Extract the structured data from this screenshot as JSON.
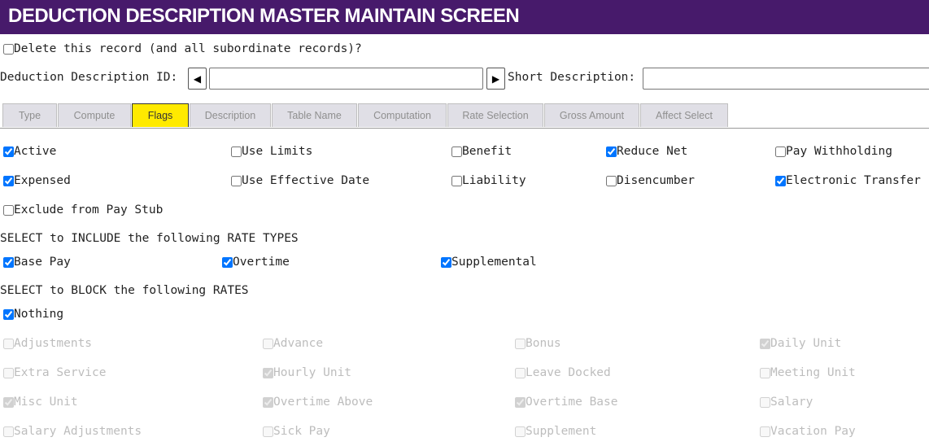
{
  "title": "DEDUCTION DESCRIPTION MASTER MAINTAIN SCREEN",
  "delete_record": {
    "label": "Delete this record (and all subordinate records)?",
    "checked": false
  },
  "deduction_id": {
    "label": "Deduction Description ID:",
    "value": "",
    "prev_icon": "triangle-left-icon",
    "next_icon": "triangle-right-icon"
  },
  "short_description": {
    "label": "Short Description:",
    "value": ""
  },
  "tabs": [
    {
      "label": "Type"
    },
    {
      "label": "Compute"
    },
    {
      "label": "Flags",
      "active": true
    },
    {
      "label": "Description"
    },
    {
      "label": "Table Name"
    },
    {
      "label": "Computation"
    },
    {
      "label": "Rate Selection"
    },
    {
      "label": "Gross Amount"
    },
    {
      "label": "Affect Select"
    }
  ],
  "flags": [
    {
      "label": "Active",
      "checked": true
    },
    {
      "label": "Use Limits",
      "checked": false
    },
    {
      "label": "Benefit",
      "checked": false
    },
    {
      "label": "Reduce Net",
      "checked": true
    },
    {
      "label": "Pay Withholding",
      "checked": false
    },
    {
      "label": "Expensed",
      "checked": true
    },
    {
      "label": "Use Effective Date",
      "checked": false
    },
    {
      "label": "Liability",
      "checked": false
    },
    {
      "label": "Disencumber",
      "checked": false
    },
    {
      "label": "Electronic Transfer",
      "checked": true
    },
    {
      "label": "Exclude from Pay Stub",
      "checked": false
    }
  ],
  "include_heading": "SELECT to INCLUDE the following RATE TYPES",
  "rate_types": [
    {
      "label": "Base Pay",
      "checked": true
    },
    {
      "label": "Overtime",
      "checked": true
    },
    {
      "label": "Supplemental",
      "checked": true
    }
  ],
  "block_heading": "SELECT to BLOCK the following RATES",
  "nothing": {
    "label": "Nothing",
    "checked": true
  },
  "block_rates": [
    {
      "label": "Adjustments",
      "checked": false
    },
    {
      "label": "Advance",
      "checked": false
    },
    {
      "label": "Bonus",
      "checked": false
    },
    {
      "label": "Daily Unit",
      "checked": true
    },
    {
      "label": "Extra Service",
      "checked": false
    },
    {
      "label": "Hourly Unit",
      "checked": true
    },
    {
      "label": "Leave Docked",
      "checked": false
    },
    {
      "label": "Meeting Unit",
      "checked": false
    },
    {
      "label": "Misc Unit",
      "checked": true
    },
    {
      "label": "Overtime Above",
      "checked": true
    },
    {
      "label": "Overtime Base",
      "checked": true
    },
    {
      "label": "Salary",
      "checked": false
    },
    {
      "label": "Salary Adjustments",
      "checked": false
    },
    {
      "label": "Sick Pay",
      "checked": false
    },
    {
      "label": "Supplement",
      "checked": false
    },
    {
      "label": "Vacation Pay",
      "checked": false
    }
  ],
  "colors": {
    "header_bg": "#471a6b",
    "active_tab": "#ffea00"
  }
}
